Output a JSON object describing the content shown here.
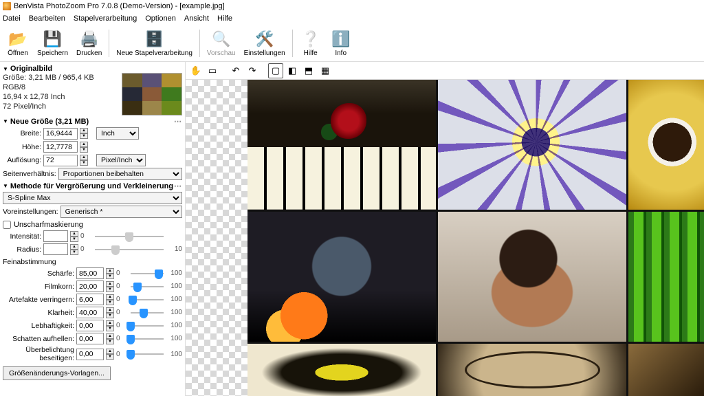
{
  "title": "BenVista PhotoZoom Pro 7.0.8 (Demo-Version) - [example.jpg]",
  "menu": {
    "items": [
      "Datei",
      "Bearbeiten",
      "Stapelverarbeitung",
      "Optionen",
      "Ansicht",
      "Hilfe"
    ]
  },
  "toolbar": {
    "open": "Öffnen",
    "save": "Speichern",
    "print": "Drucken",
    "batch": "Neue Stapelverarbeitung",
    "preview": "Vorschau",
    "settings": "Einstellungen",
    "help": "Hilfe",
    "info": "Info"
  },
  "original": {
    "header": "Originalbild",
    "size": "Größe: 3,21 MB / 965,4 KB",
    "colorspace": "RGB/8",
    "dimensions": "16,94 x 12,78 Inch",
    "resolution": "72 Pixel/Inch"
  },
  "newsize": {
    "header": "Neue Größe (3,21 MB)",
    "width_label": "Breite:",
    "width": "16,9444",
    "height_label": "Höhe:",
    "height": "12,7778",
    "res_label": "Auflösung:",
    "res": "72",
    "unit_size": "Inch",
    "unit_res": "Pixel/Inch",
    "aspect_label": "Seitenverhältnis:",
    "aspect_value": "Proportionen beibehalten"
  },
  "method": {
    "header": "Methode für Vergrößerung und Verkleinerung",
    "algo": "S-Spline Max",
    "presets_label": "Voreinstellungen:",
    "preset": "Generisch *"
  },
  "unsharp": {
    "label": "Unscharfmaskierung",
    "intensity_label": "Intensität:",
    "intensity": "",
    "int_lo": "0",
    "int_hi": "",
    "radius_label": "Radius:",
    "radius": "",
    "rad_lo": "0",
    "rad_hi": "10"
  },
  "fine": {
    "header": "Feinabstimmung",
    "items": [
      {
        "label": "Schärfe:",
        "value": "85,00",
        "lo": "0",
        "hi": "100",
        "pos": 85
      },
      {
        "label": "Filmkorn:",
        "value": "20,00",
        "lo": "0",
        "hi": "100",
        "pos": 20
      },
      {
        "label": "Artefakte verringern:",
        "value": "6,00",
        "lo": "0",
        "hi": "100",
        "pos": 6
      },
      {
        "label": "Klarheit:",
        "value": "40,00",
        "lo": "0",
        "hi": "100",
        "pos": 40
      },
      {
        "label": "Lebhaftigkeit:",
        "value": "0,00",
        "lo": "0",
        "hi": "100",
        "pos": 0
      },
      {
        "label": "Schatten aufhellen:",
        "value": "0,00",
        "lo": "0",
        "hi": "100",
        "pos": 0
      },
      {
        "label": "Überbelichtung beseitigen:",
        "value": "0,00",
        "lo": "0",
        "hi": "100",
        "pos": 0
      }
    ],
    "templates_button": "Größenänderungs-Vorlagen..."
  },
  "viewtools": {
    "icons": [
      "hand",
      "marquee",
      "sep",
      "undo",
      "redo",
      "sep",
      "single-view",
      "split-h",
      "split-v",
      "split-quad"
    ]
  }
}
